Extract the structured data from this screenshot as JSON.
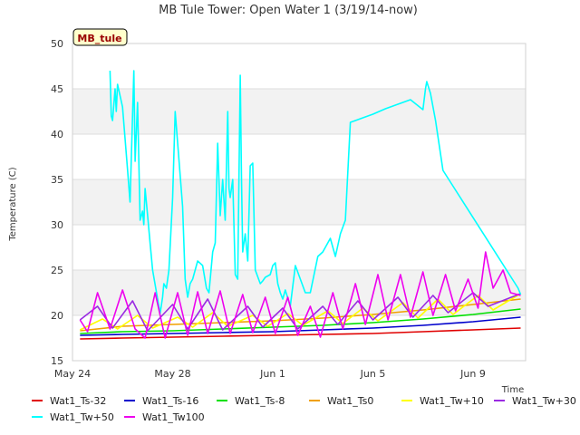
{
  "chart_data": {
    "type": "line",
    "title": "MB Tule Tower: Open Water 1 (3/19/14-now)",
    "xlabel": "Time",
    "ylabel": "Temperature (C)",
    "station_tag": "MB_tule",
    "ylim": [
      15,
      50
    ],
    "xlim": [
      0,
      18.1
    ],
    "grid": true,
    "band_fill": "#f2f2f2",
    "y_ticks": [
      "15",
      "20",
      "25",
      "30",
      "35",
      "40",
      "45",
      "50"
    ],
    "x_ticks": [
      {
        "label": "May 24",
        "day": 0
      },
      {
        "label": "May 28",
        "day": 4
      },
      {
        "label": "Jun 1",
        "day": 8
      },
      {
        "label": "Jun 5",
        "day": 12
      },
      {
        "label": "Jun 9",
        "day": 16
      }
    ],
    "series": [
      {
        "name": "Wat1_Ts-32",
        "color": "#e00000",
        "x": [
          0.3,
          2,
          4,
          6,
          8,
          10,
          12,
          14,
          16,
          17.9
        ],
        "y": [
          17.4,
          17.5,
          17.6,
          17.7,
          17.8,
          17.9,
          18.0,
          18.2,
          18.4,
          18.6
        ]
      },
      {
        "name": "Wat1_Ts-16",
        "color": "#0000cc",
        "x": [
          0.3,
          2,
          4,
          6,
          8,
          10,
          12,
          14,
          16,
          17.9
        ],
        "y": [
          17.8,
          17.9,
          18.0,
          18.1,
          18.2,
          18.4,
          18.6,
          18.9,
          19.3,
          19.8
        ]
      },
      {
        "name": "Wat1_Ts-8",
        "color": "#00e000",
        "x": [
          0.3,
          2,
          4,
          6,
          8,
          10,
          12,
          14,
          16,
          17.9
        ],
        "y": [
          18.0,
          18.2,
          18.3,
          18.5,
          18.7,
          18.9,
          19.2,
          19.6,
          20.1,
          20.7
        ]
      },
      {
        "name": "Wat1_Ts0",
        "color": "#f0a000",
        "x": [
          0.3,
          2,
          4,
          6,
          8,
          10,
          12,
          14,
          16,
          17.9
        ],
        "y": [
          18.3,
          18.8,
          19.0,
          19.2,
          19.4,
          19.7,
          20.1,
          20.6,
          21.2,
          21.8
        ]
      },
      {
        "name": "Wat1_Tw+10",
        "color": "#ffff00",
        "x": [
          0.3,
          1.2,
          1.8,
          2.6,
          3.2,
          4.2,
          4.8,
          5.6,
          6.2,
          7.2,
          7.8,
          8.6,
          9.2,
          10.2,
          10.8,
          11.6,
          12.2,
          13.2,
          13.8,
          14.6,
          15.2,
          16.2,
          16.8,
          17.9
        ],
        "y": [
          18.4,
          19.6,
          18.5,
          20.0,
          18.6,
          19.8,
          18.7,
          20.3,
          18.8,
          20.0,
          18.8,
          20.2,
          18.9,
          20.5,
          19.1,
          20.8,
          19.4,
          21.4,
          19.7,
          21.8,
          20.1,
          22.2,
          20.6,
          22.4
        ]
      },
      {
        "name": "Wat1_Tw+30",
        "color": "#9a2be2",
        "x": [
          0.3,
          1.0,
          1.6,
          2.4,
          3.0,
          4.0,
          4.6,
          5.4,
          6.0,
          7.0,
          7.6,
          8.4,
          9.0,
          10.0,
          10.6,
          11.4,
          12.0,
          13.0,
          13.6,
          14.4,
          15.0,
          16.0,
          16.6,
          17.9
        ],
        "y": [
          19.5,
          21.0,
          18.6,
          21.6,
          18.3,
          21.2,
          18.5,
          21.8,
          18.4,
          21.0,
          18.7,
          20.8,
          18.5,
          21.0,
          19.0,
          21.6,
          19.5,
          22.0,
          19.8,
          22.2,
          20.3,
          22.5,
          21.0,
          22.4
        ]
      },
      {
        "name": "Wat1_Tw+50",
        "color": "#00ffff",
        "x": [
          1.5,
          1.55,
          1.6,
          1.7,
          1.75,
          1.8,
          2.0,
          2.2,
          2.3,
          2.45,
          2.5,
          2.6,
          2.7,
          2.8,
          2.85,
          2.9,
          3.0,
          3.1,
          3.2,
          3.5,
          3.6,
          3.65,
          3.75,
          3.85,
          4.0,
          4.1,
          4.4,
          4.5,
          4.6,
          4.7,
          4.8,
          5.0,
          5.2,
          5.35,
          5.45,
          5.6,
          5.7,
          5.8,
          5.9,
          6.0,
          6.1,
          6.2,
          6.25,
          6.3,
          6.4,
          6.5,
          6.6,
          6.7,
          6.75,
          6.8,
          6.9,
          7.0,
          7.1,
          7.2,
          7.3,
          7.5,
          7.6,
          7.7,
          7.9,
          8.0,
          8.1,
          8.2,
          8.3,
          8.4,
          8.5,
          8.7,
          8.9,
          9.1,
          9.3,
          9.5,
          9.8,
          10.0,
          10.3,
          10.5,
          10.7,
          10.9,
          11.1,
          11.3,
          11.6,
          12.0,
          12.5,
          13.0,
          13.5,
          14.0,
          14.1,
          14.15,
          14.3,
          14.5,
          14.8,
          17.8,
          17.9
        ],
        "y": [
          47.0,
          42.0,
          41.5,
          45.0,
          42.5,
          45.5,
          43.0,
          36.0,
          32.5,
          47.0,
          37.0,
          43.5,
          30.5,
          31.5,
          30.0,
          34.0,
          31.0,
          28.0,
          25.0,
          20.2,
          22.0,
          23.5,
          23.0,
          25.0,
          33.0,
          42.5,
          32.0,
          24.0,
          22.0,
          23.5,
          24.0,
          26.0,
          25.5,
          23.0,
          22.5,
          27.0,
          28.0,
          39.0,
          31.0,
          35.0,
          30.5,
          42.5,
          34.0,
          33.0,
          35.0,
          24.5,
          24.0,
          46.5,
          35.0,
          27.0,
          29.0,
          26.0,
          36.5,
          36.8,
          25.0,
          23.5,
          23.8,
          24.2,
          24.5,
          25.5,
          25.8,
          23.5,
          22.5,
          21.8,
          22.8,
          21.0,
          25.5,
          24.0,
          22.5,
          22.5,
          26.5,
          27.0,
          28.5,
          26.5,
          29.0,
          30.5,
          41.3,
          41.5,
          41.8,
          42.2,
          42.8,
          43.3,
          43.8,
          42.7,
          45.0,
          45.8,
          44.5,
          41.5,
          36.0,
          23.0,
          22.3
        ]
      },
      {
        "name": "Wat1_Tw100",
        "color": "#ee00ee",
        "x": [
          0.3,
          0.6,
          1.0,
          1.5,
          2.0,
          2.5,
          2.9,
          3.3,
          3.7,
          4.2,
          4.6,
          5.0,
          5.4,
          5.9,
          6.3,
          6.8,
          7.2,
          7.7,
          8.1,
          8.6,
          9.0,
          9.5,
          9.9,
          10.4,
          10.8,
          11.3,
          11.7,
          12.2,
          12.6,
          13.1,
          13.5,
          14.0,
          14.4,
          14.9,
          15.3,
          15.8,
          16.2,
          16.5,
          16.8,
          17.2,
          17.5,
          17.9
        ],
        "y": [
          19.5,
          18.2,
          22.5,
          18.5,
          22.8,
          18.5,
          17.5,
          22.5,
          17.5,
          22.5,
          17.8,
          22.6,
          18.0,
          22.7,
          18.0,
          22.3,
          18.1,
          22.0,
          18.0,
          22.0,
          17.8,
          21.0,
          17.6,
          22.5,
          18.5,
          23.5,
          19.0,
          24.5,
          19.5,
          24.5,
          19.8,
          24.8,
          20.0,
          24.5,
          20.5,
          24.0,
          20.8,
          27.0,
          23.0,
          25.0,
          22.5,
          22.2
        ]
      }
    ]
  }
}
